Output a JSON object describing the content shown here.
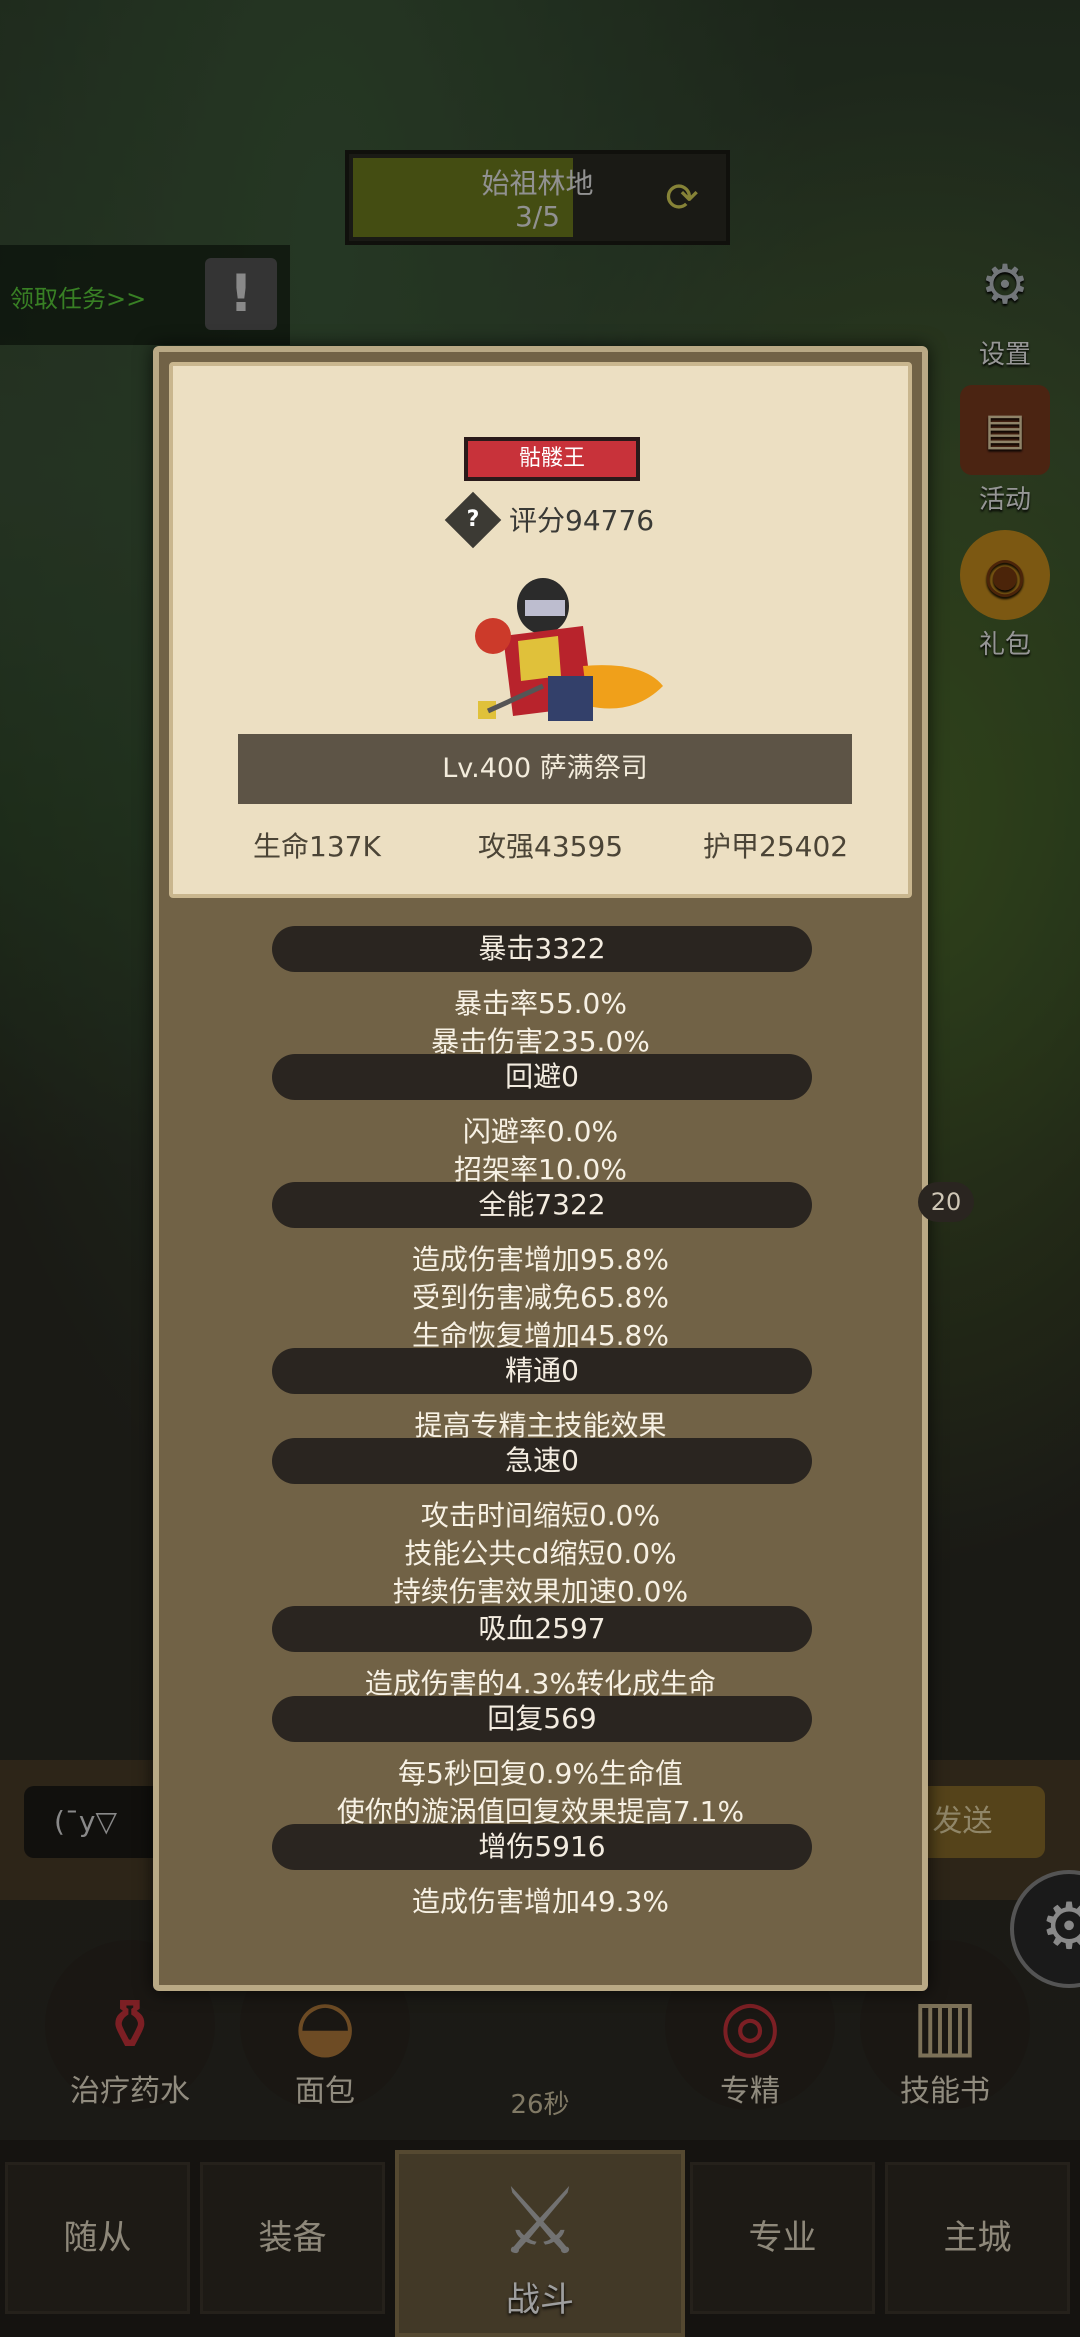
{
  "stage": {
    "name": "始祖林地",
    "progress": "3/5"
  },
  "task": {
    "label": "领取任务>>",
    "alert": "!"
  },
  "side": [
    {
      "label": "设置",
      "icon": "gear-icon"
    },
    {
      "label": "活动",
      "icon": "scroll-icon"
    },
    {
      "label": "礼包",
      "icon": "gift-icon"
    }
  ],
  "card": {
    "title": "骷髅王",
    "score": "评分94776",
    "level": "Lv.400 萨满祭司",
    "stats": [
      "生命137K",
      "攻强43595",
      "护甲25402"
    ]
  },
  "sections": [
    {
      "header": "暴击3322",
      "lines": [
        "暴击率55.0%",
        "暴击伤害235.0%"
      ]
    },
    {
      "header": "回避0",
      "lines": [
        "闪避率0.0%",
        "招架率10.0%"
      ]
    },
    {
      "header": "全能7322",
      "lines": [
        "造成伤害增加95.8%",
        "受到伤害减免65.8%",
        "生命恢复增加45.8%"
      ]
    },
    {
      "header": "精通0",
      "lines": [
        "提高专精主技能效果"
      ]
    },
    {
      "header": "急速0",
      "lines": [
        "攻击时间缩短0.0%",
        "技能公共cd缩短0.0%",
        "持续伤害效果加速0.0%"
      ]
    },
    {
      "header": "吸血2597",
      "lines": [
        "造成伤害的4.3%转化成生命"
      ]
    },
    {
      "header": "回复569",
      "lines": [
        "每5秒回复0.9%生命值",
        "使你的漩涡值回复效果提高7.1%"
      ]
    },
    {
      "header": "增伤5916",
      "lines": [
        "造成伤害增加49.3%"
      ]
    }
  ],
  "chat": {
    "input": "(¯y▽",
    "send": "发送"
  },
  "items": [
    "治疗药水",
    "面包",
    "专精",
    "技能书"
  ],
  "timer": "26秒",
  "badge": "20",
  "nav": [
    "随从",
    "装备",
    "战斗",
    "专业",
    "主城"
  ]
}
